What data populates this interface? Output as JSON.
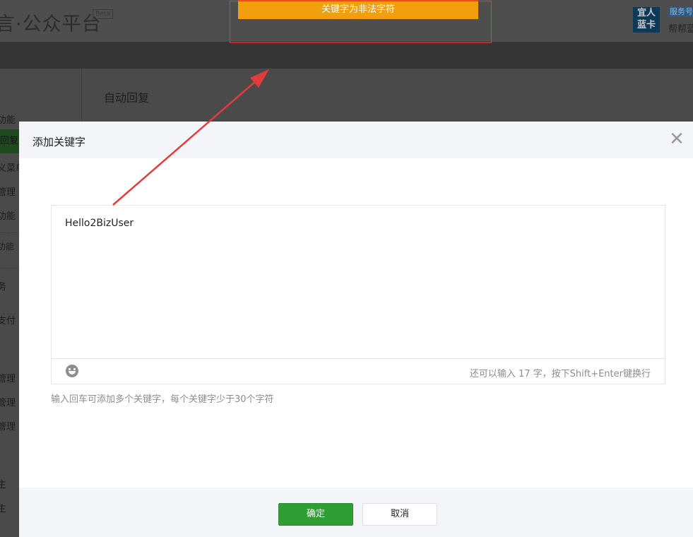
{
  "header": {
    "brand": "言·公众平台",
    "beta": "Beta",
    "qr_label": "宜人蓝卡",
    "service_badge": "服务号",
    "help_text": "帮帮蓝"
  },
  "sidebar": {
    "items": [
      "功能",
      "回复",
      "义菜单",
      "管理",
      "功能",
      "功能",
      "务",
      "支付",
      "管理",
      "管理",
      "管理",
      "主",
      "主"
    ],
    "active_index": 1
  },
  "content": {
    "title": "自动回复"
  },
  "toast": {
    "message": "关键字为非法字符"
  },
  "dialog": {
    "title": "添加关键字",
    "close_icon": "close-icon",
    "editor": {
      "value": "Hello2BizUser",
      "emoji_icon": "emoji-icon",
      "counter_text": "还可以输入 17 字，按下Shift+Enter键换行"
    },
    "hint": "输入回车可添加多个关键字，每个关键字少于30个字符",
    "buttons": {
      "confirm": "确定",
      "cancel": "取消"
    }
  },
  "colors": {
    "toast_bg": "#f0a00c",
    "annotation_red": "#e23c3c",
    "confirm_green": "#2e9e35",
    "overlay": "#4a4a4a"
  }
}
